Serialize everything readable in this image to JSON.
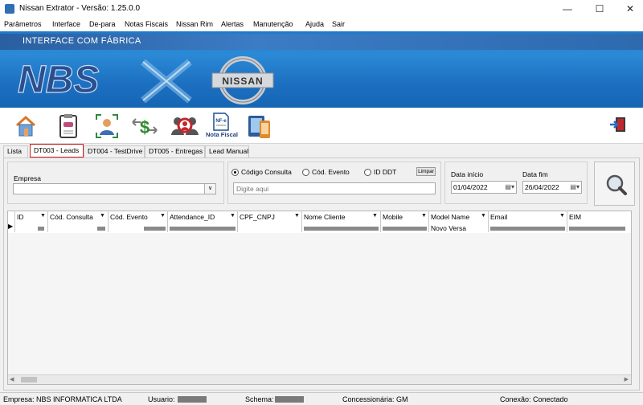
{
  "window": {
    "title": "Nissan Extrator - Versão: 1.25.0.0"
  },
  "menu": [
    "Parâmetros",
    "Interface",
    "De-para",
    "Notas Fiscais",
    "Nissan Rim",
    "Alertas",
    "Manutenção",
    "Ajuda",
    "Sair"
  ],
  "banner": {
    "title": "INTERFACE COM FÁBRICA",
    "logo_text": "NBS",
    "brand_text": "NISSAN"
  },
  "toolbar": {
    "nota_fiscal_label": "Nota Fiscal",
    "nf_badge": "NF-e"
  },
  "tabs": [
    "Lista",
    "DT003 - Leads",
    "DT004 - TestDrive",
    "DT005 - Entregas",
    "Lead Manual"
  ],
  "active_tab": "DT003 - Leads",
  "filters": {
    "empresa_label": "Empresa",
    "empresa_value": "",
    "radio_codigo_consulta": "Código Consulta",
    "radio_cod_evento": "Cód. Evento",
    "radio_id_ddt": "ID DDT",
    "selected_radio": "Código Consulta",
    "limpar_label": "Limpar",
    "search_placeholder": "Digite aqui",
    "data_inicio_label": "Data início",
    "data_inicio_value": "01/04/2022",
    "data_fim_label": "Data fim",
    "data_fim_value": "26/04/2022"
  },
  "grid": {
    "columns": [
      "ID",
      "Cód. Consulta",
      "Cód. Evento",
      "Attendance_ID",
      "CPF_CNPJ",
      "Nome Cliente",
      "Mobile",
      "Model Name",
      "Email",
      "EIM"
    ],
    "rows": [
      [
        "",
        "",
        "",
        "",
        "",
        "",
        "",
        "Novo Versa",
        "",
        ""
      ]
    ]
  },
  "status": {
    "empresa": "Empresa: NBS INFORMATICA LTDA",
    "usuario": "Usuario:",
    "schema": "Schema:",
    "concessionaria": "Concessionária: GM",
    "conexao": "Conexão: Conectado"
  },
  "colors": {
    "banner_blue": "#1f77c8",
    "active_tab_border": "#d21e1e"
  }
}
